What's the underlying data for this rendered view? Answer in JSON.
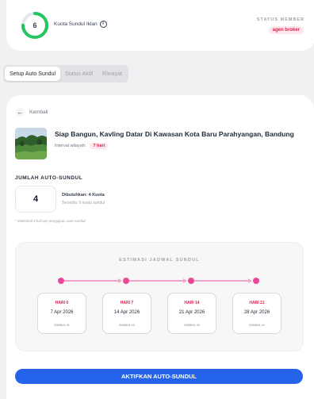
{
  "quota": {
    "count": "6",
    "label": "Kuota Sundul Iklan",
    "ring_fraction": 0.75,
    "ring_color": "#22c55e"
  },
  "member": {
    "title": "STATUS MEMBER",
    "status": "agen broker"
  },
  "tabs": [
    {
      "label": "Setup Auto Sundul",
      "active": true
    },
    {
      "label": "Status Aktif",
      "active": false
    },
    {
      "label": "Riwayat",
      "active": false
    }
  ],
  "back_label": "Kembali",
  "property": {
    "title": "Siap Bangun, Kavling Datar Di Kawasan Kota Baru Parahyangan, Bandung",
    "interval_label": "Interval wilayah:",
    "interval_value": "7 hari"
  },
  "auto_sundul": {
    "section_title": "JUMLAH AUTO-SUNDUL",
    "quantity": "4",
    "needed": "Dibutuhkan: 4 Kuota",
    "available": "Tersedia: 6 kuota sundul",
    "note": "* Maksimal 8 kali per pengajuan auto-sundul."
  },
  "schedule": {
    "title": "ESTIMASI JADWAL SUNDUL",
    "items": [
      {
        "day": "HARI 0",
        "date": "7 Apr 2026",
        "code": "SUNDUL #1"
      },
      {
        "day": "HARI 7",
        "date": "14 Apr 2026",
        "code": "SUNDUL #2"
      },
      {
        "day": "HARI 14",
        "date": "21 Apr 2026",
        "code": "SUNDUL #3"
      },
      {
        "day": "HARI 21",
        "date": "28 Apr 2026",
        "code": "SUNDUL #4"
      }
    ]
  },
  "cta_label": "AKTIFKAN AUTO-SUNDUL",
  "colors": {
    "accent_blue": "#2563eb",
    "accent_pink": "#ec4899",
    "badge_red": "#e11d48"
  }
}
